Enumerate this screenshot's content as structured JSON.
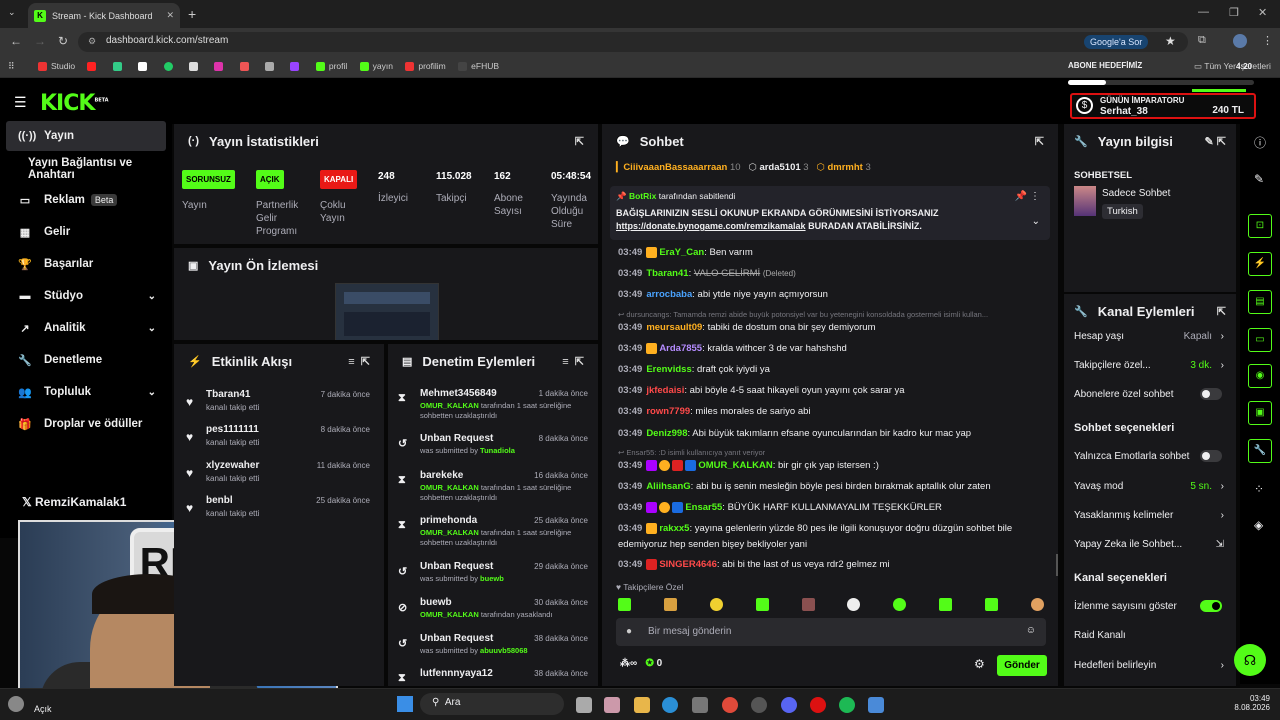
{
  "browser": {
    "tab_title": "Stream - Kick Dashboard",
    "url": "dashboard.kick.com/stream",
    "google_sor": "Google'a Sor",
    "all_bookmarks": "Tüm Yer İşaretleri",
    "bookmarks": [
      "Studio",
      "",
      "",
      "",
      "",
      "",
      "",
      "",
      "",
      "",
      "profil",
      "yayın",
      "profilim",
      "eFHUB"
    ]
  },
  "topbar": {
    "logo": "KICK",
    "beta": "BETA",
    "goal_title": "ABONE HEDEFİMİZ",
    "emperor_title": "GÜNÜN İMPARATORU",
    "emperor_name": "Serhat_38",
    "emperor_amount": "240 TL",
    "clock": "4:20"
  },
  "sidebar": {
    "items": [
      {
        "label": "Yayın",
        "icon": "broadcast-icon"
      },
      {
        "label": "Yayın Bağlantısı ve Anahtarı",
        "icon": ""
      },
      {
        "label": "Reklam",
        "icon": "ad-icon",
        "badge": "Beta"
      },
      {
        "label": "Gelir",
        "icon": "chart-icon"
      },
      {
        "label": "Başarılar",
        "icon": "trophy-icon"
      },
      {
        "label": "Stüdyo",
        "icon": "studio-icon"
      },
      {
        "label": "Analitik",
        "icon": "analytics-icon"
      },
      {
        "label": "Denetleme",
        "icon": "wrench-icon"
      },
      {
        "label": "Topluluk",
        "icon": "community-icon"
      },
      {
        "label": "Droplar ve ödüller",
        "icon": "gift-icon"
      }
    ],
    "overlay_name": "RemziKamalak1"
  },
  "stats": {
    "title": "Yayın İstatistikleri",
    "items": [
      {
        "badge": "SORUNSUZ",
        "label": "Yayın"
      },
      {
        "badge": "AÇIK",
        "label": "Partnerlik Gelir Programı"
      },
      {
        "badge": "KAPALI",
        "label": "Çoklu Yayın"
      },
      {
        "value": "248",
        "label": "İzleyici"
      },
      {
        "value": "115.028",
        "label": "Takipçi"
      },
      {
        "value": "162",
        "label": "Abone Sayısı"
      },
      {
        "value": "05:48:54",
        "label": "Yayında Olduğu Süre"
      }
    ]
  },
  "preview": {
    "title": "Yayın Ön İzlemesi"
  },
  "activity": {
    "title": "Etkinlik Akışı",
    "items": [
      {
        "name": "Tbaran41",
        "sub": "kanalı takip etti",
        "time": "7 dakika önce"
      },
      {
        "name": "pes1111111",
        "sub": "kanalı takip etti",
        "time": "8 dakika önce"
      },
      {
        "name": "xlyzewaher",
        "sub": "kanalı takip etti",
        "time": "11 dakika önce"
      },
      {
        "name": "benbl",
        "sub": "kanalı takip etti",
        "time": "25 dakika önce"
      }
    ]
  },
  "moderation": {
    "title": "Denetim Eylemleri",
    "items": [
      {
        "name": "Mehmet3456849",
        "time": "1 dakika önce",
        "who": "OMUR_KALKAN",
        "text": "tarafından 1 saat süreliğine sohbetten uzaklaştırıldı",
        "icon": "hourglass-icon"
      },
      {
        "name": "Unban Request",
        "time": "8 dakika önce",
        "pre": "was submitted by",
        "who": "Tunadiola",
        "icon": "undo-icon"
      },
      {
        "name": "barekeke",
        "time": "16 dakika önce",
        "who": "OMUR_KALKAN",
        "text": "tarafından 1 saat süreliğine sohbetten uzaklaştırıldı",
        "icon": "hourglass-icon"
      },
      {
        "name": "primehonda",
        "time": "25 dakika önce",
        "who": "OMUR_KALKAN",
        "text": "tarafından 1 saat süreliğine sohbetten uzaklaştırıldı",
        "icon": "hourglass-icon"
      },
      {
        "name": "Unban Request",
        "time": "29 dakika önce",
        "pre": "was submitted by",
        "who": "buewb",
        "icon": "undo-icon"
      },
      {
        "name": "buewb",
        "time": "30 dakika önce",
        "who": "OMUR_KALKAN",
        "text": "tarafından yasaklandı",
        "icon": "ban-icon"
      },
      {
        "name": "Unban Request",
        "time": "38 dakika önce",
        "pre": "was submitted by",
        "who": "abuuvb58068",
        "icon": "undo-icon"
      },
      {
        "name": "lutfennnyaya12",
        "time": "38 dakika önce",
        "icon": "hourglass-icon"
      }
    ]
  },
  "chat": {
    "title": "Sohbet",
    "top_users": [
      {
        "name": "CiiivaaanBassaaarraan",
        "count": "10"
      },
      {
        "name": "arda5101",
        "count": "3"
      },
      {
        "name": "dmrmht",
        "count": "3"
      }
    ],
    "pinned": {
      "user": "BotRix",
      "label": "tarafından sabitlendi",
      "text1": "BAĞIŞLARINIZIN SESLİ OKUNUP EKRANDA GÖRÜNMESİNİ İSTİYORSANIZ",
      "link": "https://donate.bynogame.com/remzikamalak",
      "text2": "BURADAN ATABİLİRSİNİZ."
    },
    "messages": [
      {
        "time": "03:49",
        "user": "EraY_Can",
        "color": "#53fc18",
        "text": "Ben varım"
      },
      {
        "time": "03:49",
        "user": "Tbaran41",
        "color": "#53fc18",
        "text": "VALO GELİRMİ",
        "deleted": "(Deleted)"
      },
      {
        "time": "03:49",
        "user": "arrocbaba",
        "color": "#4aa3ff",
        "text": "abi ytde niye yayın açmıyorsun"
      },
      {
        "reply": "dursuncangs: Tamamda remzi abide buyük potonsiyel var bu yetenegini konsoldada gostermeli isimli kullan..."
      },
      {
        "time": "03:49",
        "user": "meursault09",
        "color": "#ffb020",
        "text": "tabiki de dostum ona bir şey demiyorum"
      },
      {
        "time": "03:49",
        "user": "Arda7855",
        "color": "#b58cff",
        "text": "kralda withcer 3 de var hahshshd"
      },
      {
        "time": "03:49",
        "user": "Erenvidss",
        "color": "#53fc18",
        "text": "draft çok iyiydi ya"
      },
      {
        "time": "03:49",
        "user": "jkfedaisi",
        "color": "#ff4a4a",
        "text": "abi böyle 4-5 saat hikayeli oyun yayını çok sarar ya"
      },
      {
        "time": "03:49",
        "user": "rown7799",
        "color": "#ff4a4a",
        "text": "miles morales de sariyo abi"
      },
      {
        "time": "03:49",
        "user": "Deniz998",
        "color": "#53fc18",
        "text": "Abi büyük takımların efsane oyuncularından bir kadro kur mac yap"
      },
      {
        "reply": "Ensar55: :D isimli kullanıcıya yanıt veriyor"
      },
      {
        "time": "03:49",
        "user": "OMUR_KALKAN",
        "color": "#53fc18",
        "text": "bir gir çık yap istersen :)"
      },
      {
        "time": "03:49",
        "user": "AliihsanG",
        "color": "#53fc18",
        "text": "abi bu iş senin mesleğin böyle pesi birden bırakmak aptallık olur zaten"
      },
      {
        "time": "03:49",
        "user": "Ensar55",
        "color": "#53fc18",
        "text": "BÜYÜK HARF KULLANMAYALIM TEŞEKKÜRLER"
      },
      {
        "time": "03:49",
        "user": "rakxx5",
        "color": "#53fc18",
        "text": "yayına gelenlerin yüzde 80 pes ile ilgili konuşuyor doğru düzgün sohbet bile"
      },
      {
        "cont": "edemiyoruz hep senden bişey bekliyoler yani"
      },
      {
        "time": "03:49",
        "user": "SINGER4646",
        "color": "#ff4a4a",
        "text": "abi bi the last of us veya rdr2 gelmez mi"
      }
    ],
    "emote_label": "Takipçilere Özel",
    "input_placeholder": "Bir mesaj gönderin",
    "points": "0",
    "send": "Gönder"
  },
  "info": {
    "title": "Yayın bilgisi",
    "category": "SOHBETSEL",
    "stream_title": "Sadece Sohbet",
    "lang": "Turkish"
  },
  "actions": {
    "title": "Kanal Eylemleri",
    "rows": [
      {
        "label": "Hesap yaşı",
        "value": "Kapalı"
      },
      {
        "label": "Takipçilere özel...",
        "value": "3 dk."
      },
      {
        "label": "Abonelere özel sohbet"
      }
    ],
    "chat_section": "Sohbet seçenekleri",
    "chat_rows": [
      {
        "label": "Yalnızca Emotlarla sohbet"
      },
      {
        "label": "Yavaş mod",
        "value": "5 sn."
      },
      {
        "label": "Yasaklanmış kelimeler"
      },
      {
        "label": "Yapay Zeka ile Sohbet..."
      }
    ],
    "channel_section": "Kanal seçenekleri",
    "channel_rows": [
      {
        "label": "İzlenme sayısını göster"
      },
      {
        "label": "Raid Kanalı"
      },
      {
        "label": "Hedefleri belirleyin"
      }
    ]
  },
  "taskbar": {
    "weather": "Açık",
    "search": "Ara",
    "time": "03:49",
    "date": "8.08.2026"
  },
  "colors": {
    "accent": "#53fc18",
    "panel": "#18181b",
    "bg": "#070707"
  }
}
